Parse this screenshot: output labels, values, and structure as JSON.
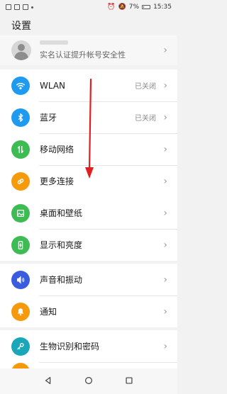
{
  "status_bar": {
    "battery": "7%",
    "time": "15:35"
  },
  "page": {
    "title": "设置"
  },
  "profile": {
    "subtitle": "实名认证提升帐号安全性"
  },
  "groups": [
    {
      "items": [
        {
          "label": "WLAN",
          "status": "已关闭",
          "icon": "wifi-icon",
          "color": "#1e9bf0"
        },
        {
          "label": "蓝牙",
          "status": "已关闭",
          "icon": "bluetooth-icon",
          "color": "#1e9bf0"
        },
        {
          "label": "移动网络",
          "status": "",
          "icon": "mobile-data-icon",
          "color": "#3ebb53"
        },
        {
          "label": "更多连接",
          "status": "",
          "icon": "link-icon",
          "color": "#f59a0c"
        }
      ]
    },
    {
      "items": [
        {
          "label": "桌面和壁纸",
          "status": "",
          "icon": "wallpaper-icon",
          "color": "#3ebb53"
        },
        {
          "label": "显示和亮度",
          "status": "",
          "icon": "display-icon",
          "color": "#3ebb53"
        }
      ]
    },
    {
      "items": [
        {
          "label": "声音和振动",
          "status": "",
          "icon": "volume-icon",
          "color": "#3a5de0"
        },
        {
          "label": "通知",
          "status": "",
          "icon": "bell-icon",
          "color": "#f59a0c"
        }
      ]
    },
    {
      "items": [
        {
          "label": "生物识别和密码",
          "status": "",
          "icon": "key-icon",
          "color": "#18a6b9"
        }
      ]
    }
  ],
  "annotation": {
    "color": "#e02020"
  },
  "nav_bar": {
    "icons": [
      "back-icon",
      "home-icon",
      "recents-icon"
    ]
  }
}
